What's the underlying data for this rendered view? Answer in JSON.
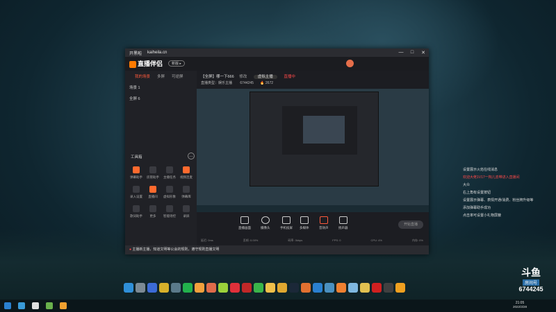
{
  "window": {
    "title": "开黑啦",
    "url": "kaiheila.cn",
    "controls": [
      "—",
      "□",
      "✕"
    ]
  },
  "app": {
    "logo": "直播伴侣",
    "version_button": "新版 ▸"
  },
  "side": {
    "tabs": [
      "我的场景",
      "多屏",
      "可逆屏"
    ],
    "scene": "场景 1",
    "scene_item": "全屏 6",
    "tools_title": "工具箱",
    "tools": [
      "弹幕助手",
      "房管助手",
      "主播任务",
      "视频连麦",
      "录入设置",
      "直播间",
      "虚拟形象",
      "弹幕库",
      "歌词助手",
      "更多",
      "智能场控",
      "录屏"
    ]
  },
  "room": {
    "title": "【全屏】哪一下666",
    "edit": "修改",
    "category": "虚拟主播",
    "status": "直播中",
    "line2": "直播类型：娱乐主播",
    "viewers": "6744245",
    "hot": "2672"
  },
  "controls": [
    "直播画面",
    "摄像头",
    "手机投屏",
    "多媒体",
    "音效声",
    "扬声器"
  ],
  "start_button": "开始直播",
  "stats": [
    "延迟: 0ms",
    "丢帧: 0.00%",
    "码率: 0kbps",
    "FPS: 0",
    "CPU: 4%",
    "内存: 0%"
  ],
  "notice": "主播新主播，知道文明等公会的规则，遵守规则直播文明",
  "chat": [
    {
      "text": "设置展示火焰在线消息",
      "cls": ""
    },
    {
      "text": "欢迎大佬1V17一掏儿去带进入直播间",
      "cls": "red"
    },
    {
      "text": "",
      "cls": ""
    },
    {
      "text": "大众",
      "cls": ""
    },
    {
      "text": "右上角有设置按钮",
      "cls": ""
    },
    {
      "text": "设置展示弹幕、表情开通/消费、粉丝牌升级等",
      "cls": ""
    },
    {
      "text": "添加弹幕助手成功",
      "cls": ""
    },
    {
      "text": "点击率可设置小礼物屏蔽",
      "cls": ""
    }
  ],
  "douyu": {
    "logo": "斗鱼",
    "tag": "房间号",
    "room_no": "6744245",
    "date": "2022/3/28"
  },
  "taskbar": {
    "time": "21:05",
    "date": "2022/3/28"
  }
}
